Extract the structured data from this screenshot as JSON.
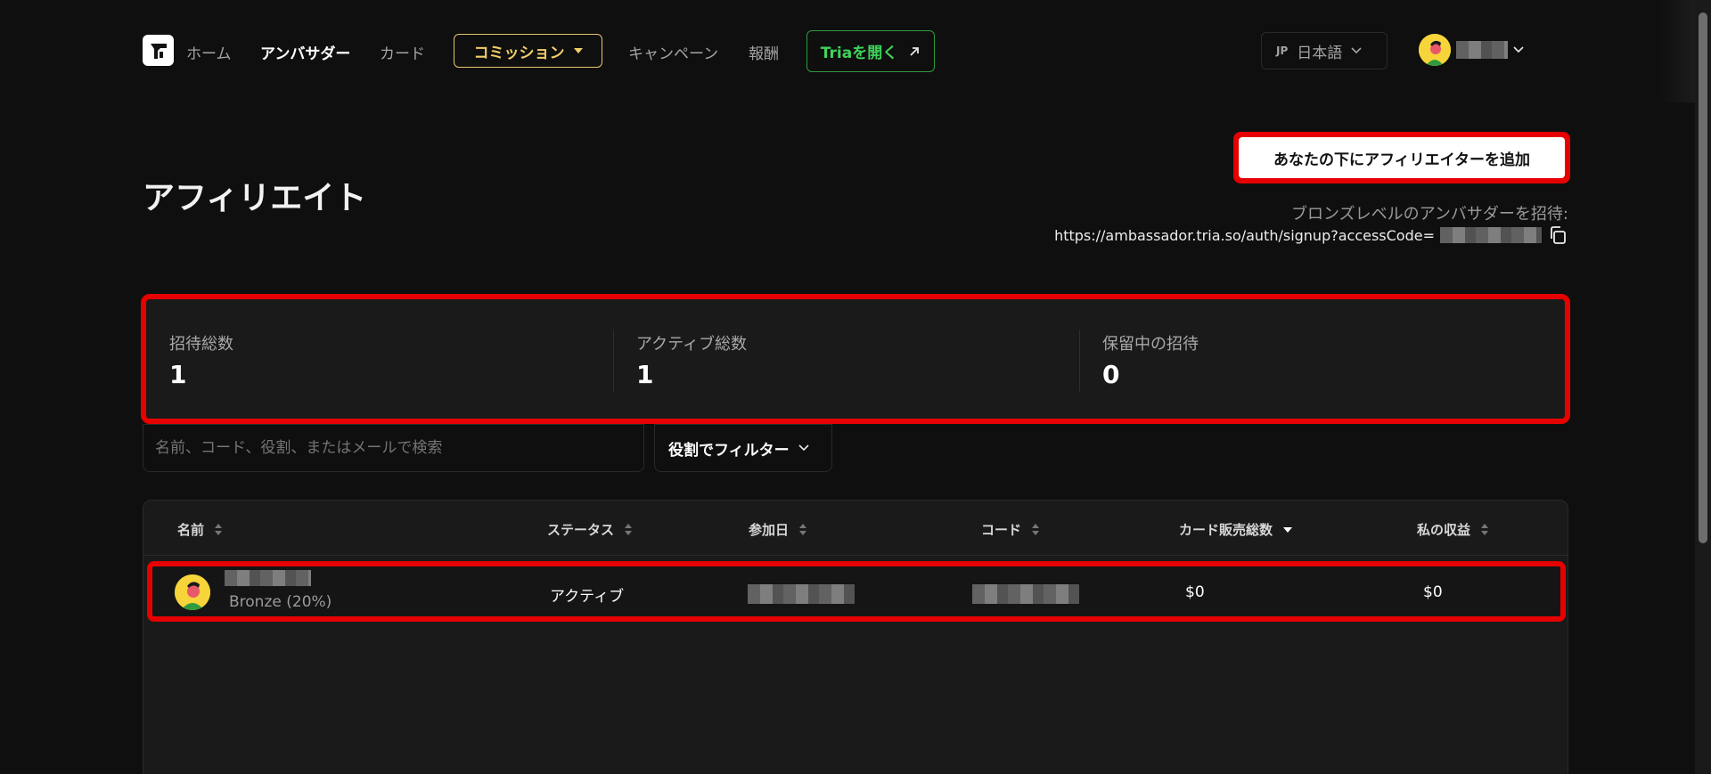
{
  "nav": {
    "home": "ホーム",
    "ambassador": "アンバサダー",
    "card": "カード",
    "commission": "コミッション",
    "campaign": "キャンペーン",
    "rewards": "報酬",
    "tria_open": "Triaを開く",
    "lang_code": "JP",
    "lang_label": "日本語"
  },
  "page": {
    "title": "アフィリエイト",
    "add_button": "あなたの下にアフィリエイターを追加",
    "invite_label": "ブロンズレベルのアンバサダーを招待:",
    "invite_link": "https://ambassador.tria.so/auth/signup?accessCode="
  },
  "stats": [
    {
      "label": "招待総数",
      "value": "1"
    },
    {
      "label": "アクティブ総数",
      "value": "1"
    },
    {
      "label": "保留中の招待",
      "value": "0"
    }
  ],
  "search": {
    "placeholder": "名前、コード、役割、またはメールで検索"
  },
  "filter": {
    "label": "役割でフィルター"
  },
  "table": {
    "columns": [
      "名前",
      "ステータス",
      "参加日",
      "コード",
      "カード販売総数",
      "私の収益"
    ],
    "rows": [
      {
        "role": "Bronze (20%)",
        "status": "アクティブ",
        "card_sales": "$0",
        "earnings": "$0"
      }
    ]
  },
  "colors": {
    "background": "#0f0f0f",
    "highlight": "#e60000",
    "commission_accent": "#f2cd6a",
    "tria_green": "#3fd35a"
  }
}
